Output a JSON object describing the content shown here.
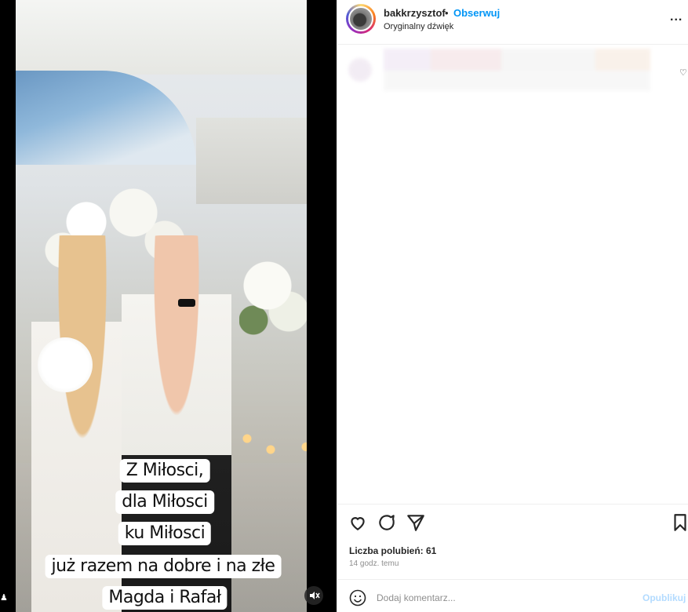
{
  "media": {
    "caption_lines": [
      "Z Miłosci,",
      "dla Miłosci",
      "ku Miłosci",
      "już razem na dobre i na złe",
      "Magda i Rafał"
    ],
    "mute_icon": "speaker-muted-icon"
  },
  "header": {
    "username": "bakkrzysztof",
    "separator": "•",
    "follow_label": "Obserwuj",
    "audio_label": "Oryginalny dźwięk",
    "more_label": "..."
  },
  "actions": {
    "like_icon": "heart-icon",
    "comment_icon": "comment-bubble-icon",
    "share_icon": "send-icon",
    "save_icon": "bookmark-icon"
  },
  "stats": {
    "likes_text": "Liczba polubień: 61",
    "time_text": "14 godz. temu"
  },
  "comment_box": {
    "placeholder": "Dodaj komentarz...",
    "publish_label": "Opublikuj",
    "emoji_icon": "smiley-icon"
  },
  "colors": {
    "accent": "#0095f6",
    "publish_disabled": "#b3dbff",
    "text": "#262626",
    "muted": "#8e8e8e"
  }
}
